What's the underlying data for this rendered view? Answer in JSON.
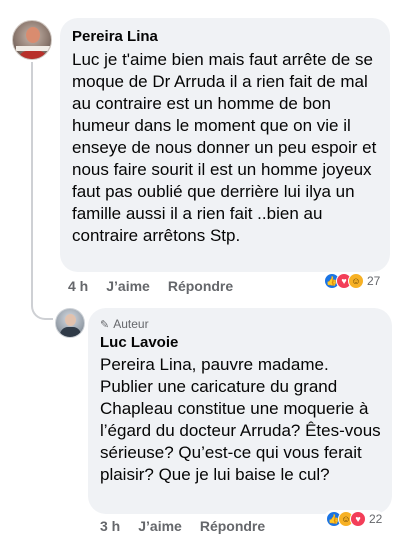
{
  "comments": [
    {
      "author": "Pereira Lina",
      "text": "Luc je t'aime bien mais faut arrête de se moque  de Dr Arruda  il a rien fait de mal au contraire  est  un homme de bon humeur dans le moment que on vie il enseye de nous donner un peu espoir  et nous faire sourit  il est un homme joyeux  faut pas oublié  que derrière lui ilya un famille  aussi  il a rien fait ..bien au contraire arrêtons Stp.",
      "time": "4 h",
      "like_label": "J’aime",
      "reply_label": "Répondre",
      "reactions": [
        "like-icon",
        "love-icon",
        "haha-icon"
      ],
      "reaction_count": "27"
    },
    {
      "author_badge": "Auteur",
      "author": "Luc Lavoie",
      "text": "Pereira Lina, pauvre madame. Publier une caricature du grand Chapleau constitue une moquerie à l’égard du docteur Arruda? Êtes-vous sérieuse? Qu’est-ce qui vous ferait plaisir? Que je lui baise le cul?",
      "time": "3 h",
      "like_label": "J’aime",
      "reply_label": "Répondre",
      "reactions": [
        "like-icon",
        "haha-icon",
        "love-icon"
      ],
      "reaction_count": "22"
    }
  ],
  "colors": {
    "bubble": "#f0f2f5",
    "secondary_text": "#65676b",
    "like": "#1b74e4",
    "love": "#f33e58",
    "haha": "#f7b125"
  }
}
